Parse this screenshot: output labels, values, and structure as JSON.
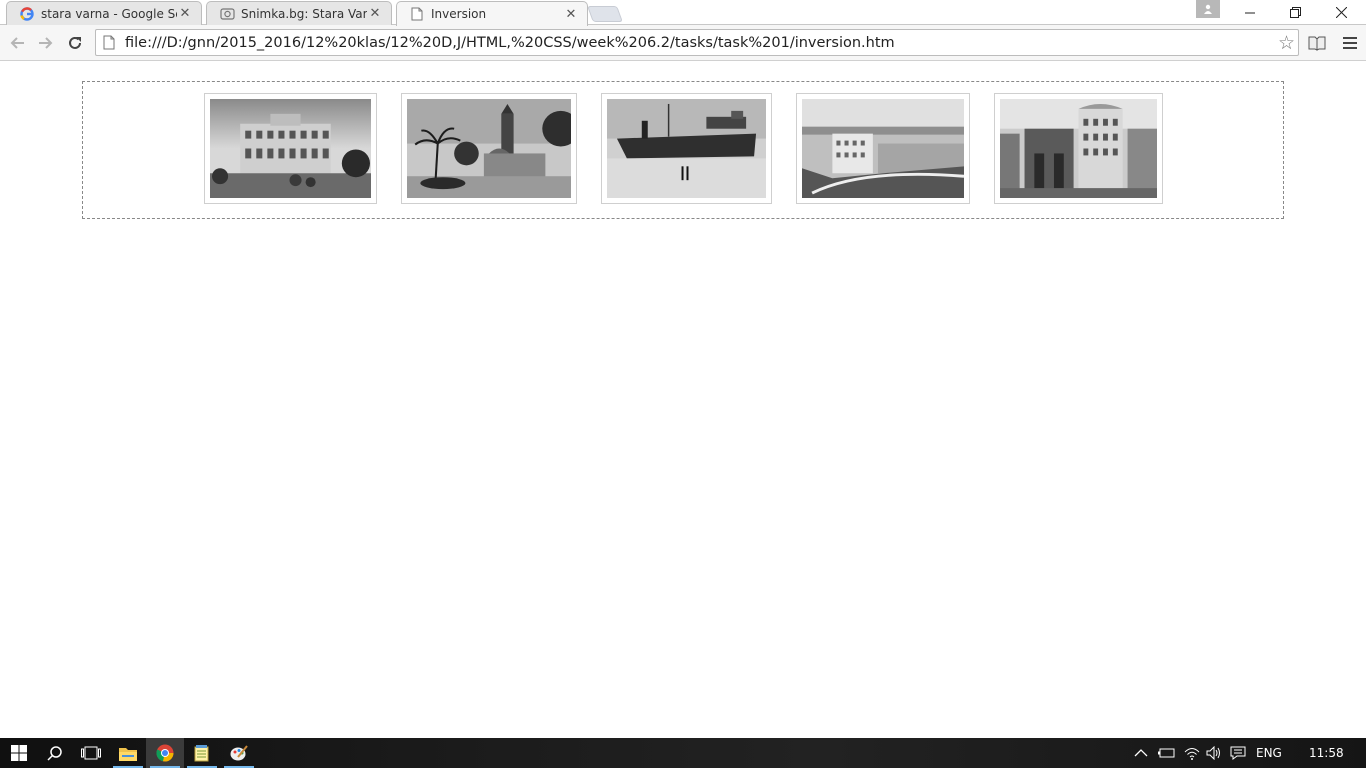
{
  "browser": {
    "tabs": [
      {
        "title": "stara varna - Google Searc",
        "favicon": "google-icon",
        "active": false
      },
      {
        "title": "Snimka.bg: Stara Varna - K",
        "favicon": "snimka-icon",
        "active": false
      },
      {
        "title": "Inversion",
        "favicon": "page-icon",
        "active": true
      }
    ],
    "address": "file:///D:/gnn/2015_2016/12%20klas/12%20D,J/HTML,%20CSS/week%206.2/tasks/task%201/inversion.htm",
    "close_glyph": "✕"
  },
  "gallery": {
    "photos": [
      {
        "subject": "building with gardens"
      },
      {
        "subject": "clock tower with palm trees"
      },
      {
        "subject": "ship in harbor"
      },
      {
        "subject": "city panorama"
      },
      {
        "subject": "corner building street"
      }
    ]
  },
  "taskbar": {
    "language": "ENG",
    "time": "11:58"
  }
}
